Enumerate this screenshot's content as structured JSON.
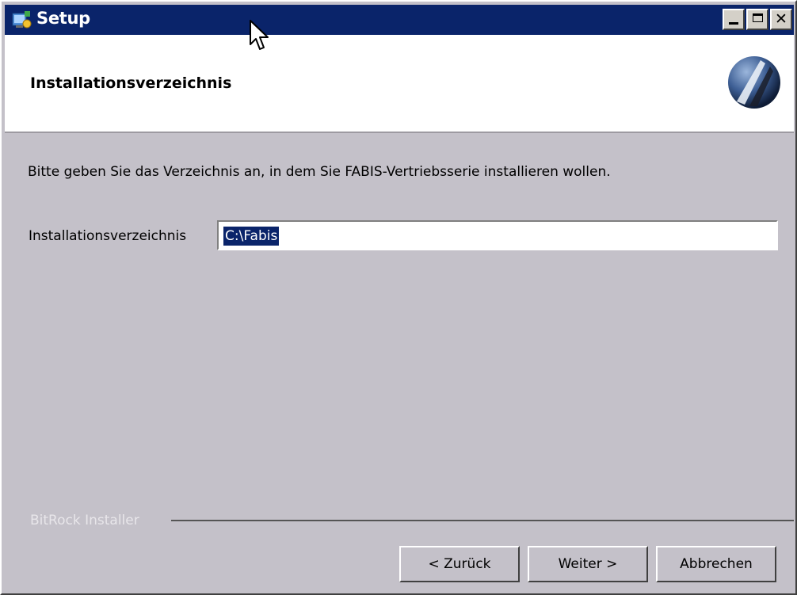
{
  "window": {
    "title": "Setup"
  },
  "header": {
    "title": "Installationsverzeichnis"
  },
  "main": {
    "intro": "Bitte geben Sie das Verzeichnis an, in dem Sie  FABIS-Vertriebsserie installieren wollen.",
    "directory_label": "Installationsverzeichnis",
    "directory_value": "C:\\Fabis"
  },
  "footer": {
    "brand": "BitRock Installer",
    "back_label": "< Zurück",
    "next_label": "Weiter >",
    "cancel_label": "Abbrechen"
  },
  "colors": {
    "titlebar": "#0a246a",
    "window_bg": "#c4c1c9",
    "selection": "#0a246a"
  },
  "icons": [
    "setup-app-icon",
    "minimize-icon",
    "maximize-icon",
    "close-icon",
    "installer-logo-icon",
    "mouse-cursor-icon"
  ]
}
